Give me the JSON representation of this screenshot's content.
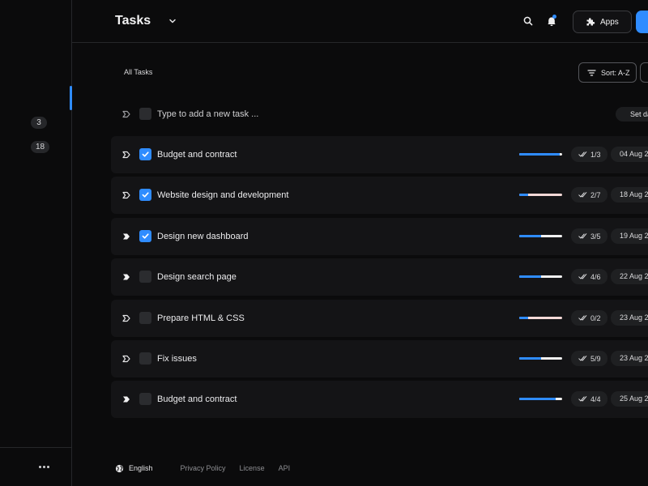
{
  "header": {
    "title": "Tasks",
    "apps_label": "Apps",
    "icons": [
      "chevron-down-icon",
      "search-icon",
      "bell-icon",
      "puzzle-icon"
    ],
    "accent": "#2f8cff"
  },
  "sidebar": {
    "badges": [
      "3",
      "18"
    ]
  },
  "toolbar": {
    "section_label": "All Tasks",
    "sort_label": "Sort: A-Z"
  },
  "new_task": {
    "placeholder": "Type to add a new task ...",
    "set_date_label": "Set da"
  },
  "tasks": [
    {
      "title": "Budget and contract",
      "checked": true,
      "progress": 0.95,
      "subtasks": "1/3",
      "date": "04 Aug 2",
      "priority": "outline"
    },
    {
      "title": "Website design and development",
      "checked": true,
      "progress": 0.2,
      "subtasks": "2/7",
      "date": "18 Aug 2",
      "priority": "outline"
    },
    {
      "title": "Design new dashboard",
      "checked": true,
      "progress": 0.5,
      "subtasks": "3/5",
      "date": "19 Aug 2",
      "priority": "filled"
    },
    {
      "title": "Design search page",
      "checked": false,
      "progress": 0.5,
      "subtasks": "4/6",
      "date": "22 Aug 2",
      "priority": "filled"
    },
    {
      "title": "Prepare HTML & CSS",
      "checked": false,
      "progress": 0.2,
      "subtasks": "0/2",
      "date": "23 Aug 2",
      "priority": "outline"
    },
    {
      "title": "Fix issues",
      "checked": false,
      "progress": 0.5,
      "subtasks": "5/9",
      "date": "23 Aug 2",
      "priority": "outline"
    },
    {
      "title": "Budget and contract",
      "checked": false,
      "progress": 0.85,
      "subtasks": "4/4",
      "date": "25 Aug 2",
      "priority": "filled"
    }
  ],
  "footer": {
    "language": "English",
    "links": [
      "Privacy Policy",
      "License",
      "API"
    ]
  }
}
